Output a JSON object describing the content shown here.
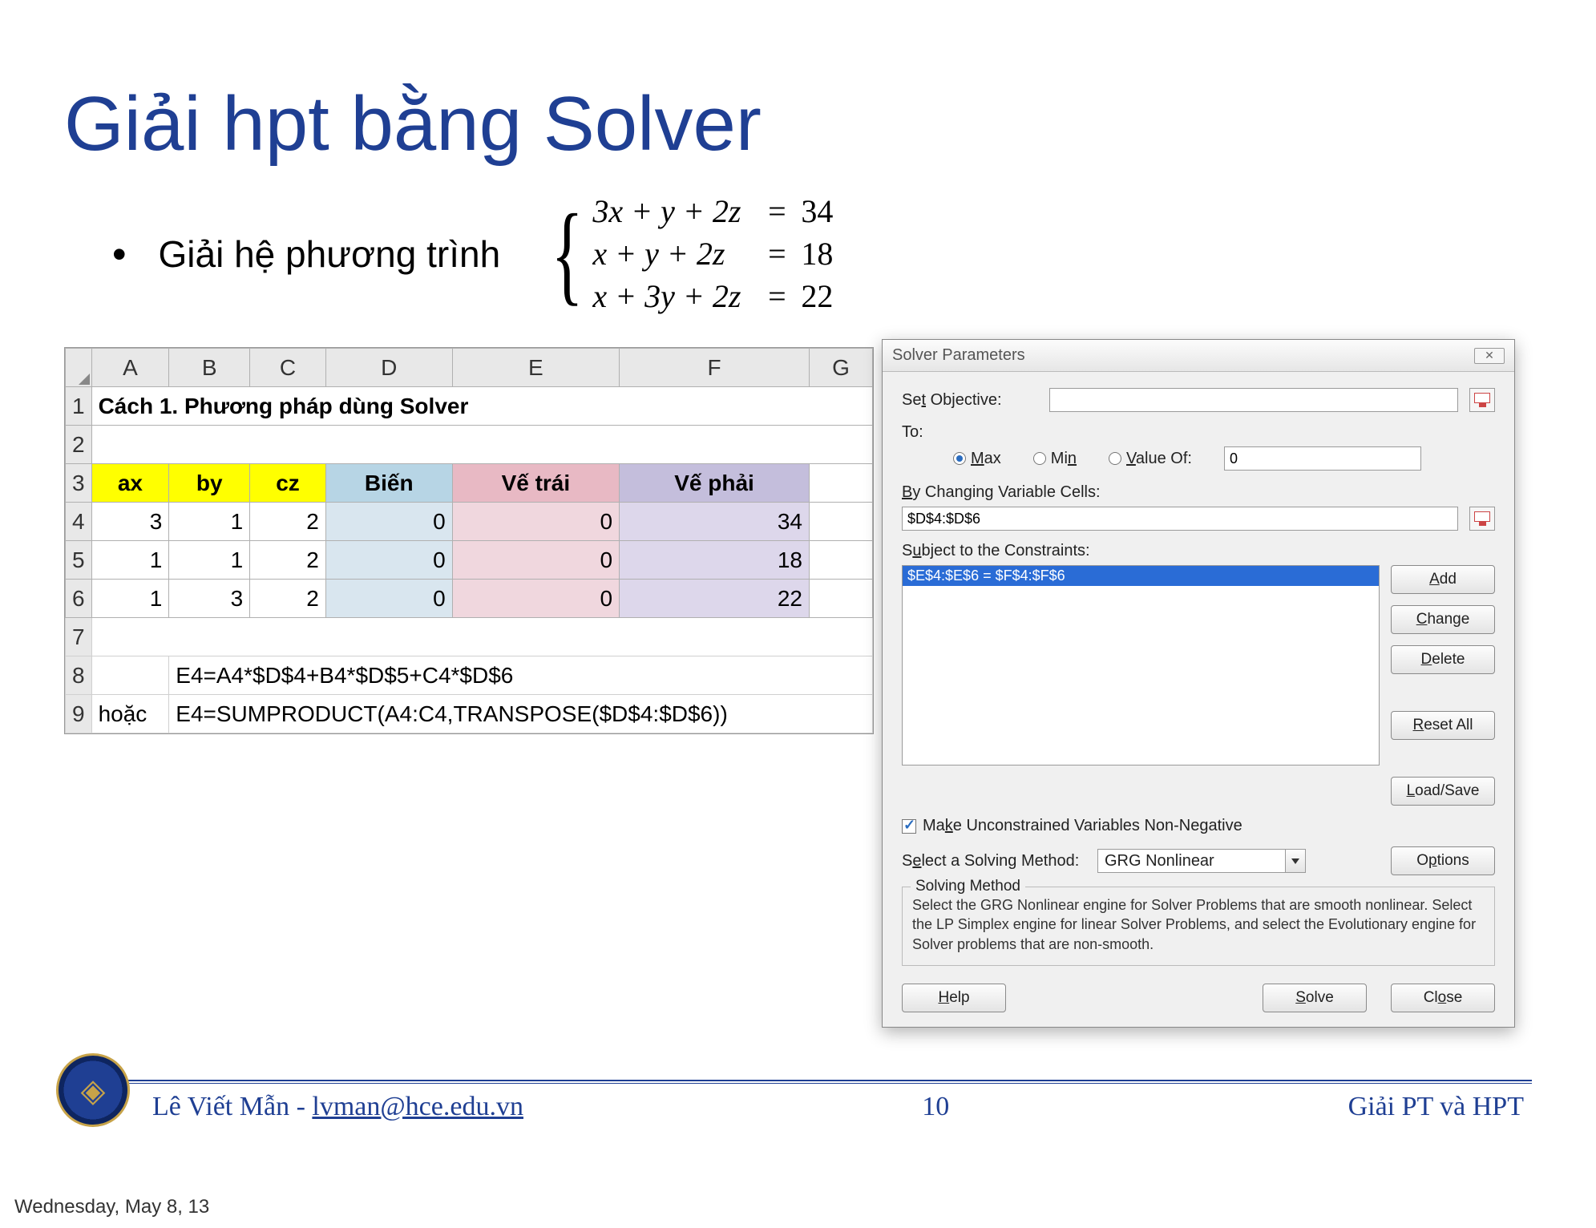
{
  "slide": {
    "title": "Giải hpt bằng Solver",
    "bullet": "Giải hệ phương trình",
    "equations": [
      {
        "lhs_html": "3<i>x</i> + <i>y</i> + 2<i>z</i>",
        "rhs": "34"
      },
      {
        "lhs_html": "<i>x</i> + <i>y</i> + 2<i>z</i>",
        "rhs": "18"
      },
      {
        "lhs_html": "<i>x</i> + 3<i>y</i> + 2<i>z</i>",
        "rhs": "22"
      }
    ]
  },
  "excel": {
    "columns": [
      "A",
      "B",
      "C",
      "D",
      "E",
      "F",
      "G"
    ],
    "row1_text": "Cách 1. Phương pháp dùng Solver",
    "headers": [
      "ax",
      "by",
      "cz",
      "Biến",
      "Vế trái",
      "Vế phải"
    ],
    "data_rows": [
      {
        "a": "3",
        "b": "1",
        "c": "2",
        "d": "0",
        "e": "0",
        "f": "34"
      },
      {
        "a": "1",
        "b": "1",
        "c": "2",
        "d": "0",
        "e": "0",
        "f": "18"
      },
      {
        "a": "1",
        "b": "3",
        "c": "2",
        "d": "0",
        "e": "0",
        "f": "22"
      }
    ],
    "formula1": "E4=A4*$D$4+B4*$D$5+C4*$D$6",
    "hoac": "hoặc",
    "formula2": "E4=SUMPRODUCT(A4:C4,TRANSPOSE($D$4:$D$6))"
  },
  "solver": {
    "title": "Solver Parameters",
    "set_objective_label": "Set Objective:",
    "set_objective_value": "",
    "to_label": "To:",
    "radios": {
      "max": "Max",
      "min": "Min",
      "value_of": "Value Of:"
    },
    "value_of_value": "0",
    "by_changing_label": "By Changing Variable Cells:",
    "by_changing_value": "$D$4:$D$6",
    "subject_label": "Subject to the Constraints:",
    "constraint_selected": "$E$4:$E$6 = $F$4:$F$6",
    "buttons": {
      "add": "Add",
      "change": "Change",
      "delete": "Delete",
      "reset_all": "Reset All",
      "load_save": "Load/Save",
      "options": "Options",
      "help": "Help",
      "solve": "Solve",
      "close": "Close"
    },
    "checkbox_label": "Make Unconstrained Variables Non-Negative",
    "select_method_label": "Select a Solving Method:",
    "select_method_value": "GRG Nonlinear",
    "fieldset_legend": "Solving Method",
    "fieldset_text": "Select the GRG Nonlinear engine for Solver Problems that are smooth nonlinear. Select the LP Simplex engine for linear Solver Problems, and select the Evolutionary engine for Solver problems that are non-smooth."
  },
  "footer": {
    "author": "Lê Viết Mẫn - ",
    "email": "lvman@hce.edu.vn",
    "page_number": "10",
    "right_text": "Giải PT và HPT",
    "date": "Wednesday, May 8, 13"
  }
}
